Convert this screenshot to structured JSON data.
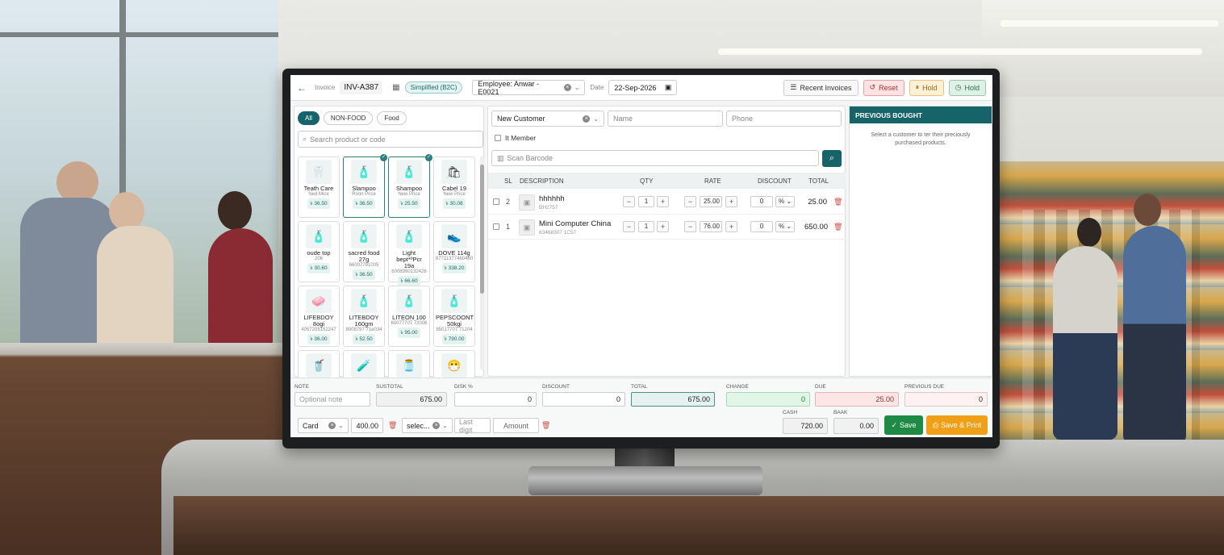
{
  "topbar": {
    "invoice_label": "Invoice",
    "invoice_no": "INV-A387",
    "mode": "Simplified (B2C)",
    "employee": "Employee: Anwar - E0021",
    "date_label": "Date",
    "date": "22-Sep-2026",
    "recent_invoices": "Recent Invoices",
    "reset": "Reset",
    "hold": "Hold",
    "hold2": "Hold"
  },
  "categories": [
    "All",
    "NON-FOOD",
    "Food"
  ],
  "search_placeholder": "Search product or code",
  "products": [
    {
      "name": "Teath Care",
      "sub": "Ned Mice",
      "price": "৳ 36.50",
      "icon": "tooth-icon",
      "glyph": "🦷",
      "selected": false
    },
    {
      "name": "Slampoo",
      "sub": "Roon Price",
      "price": "৳ 36.50",
      "icon": "bottle-icon",
      "glyph": "🧴",
      "selected": true
    },
    {
      "name": "Shampoo",
      "sub": "New Price",
      "price": "৳ 25.50",
      "icon": "bottle-icon",
      "glyph": "🧴",
      "selected": true
    },
    {
      "name": "Cabel 19",
      "sub": "New Price",
      "price": "৳ 30.08",
      "icon": "bag-icon",
      "glyph": "🛍",
      "selected": false
    },
    {
      "name": "oude top",
      "sub": "206",
      "price": "৳ 30.60",
      "icon": "bottle-icon",
      "glyph": "🧴",
      "selected": false
    },
    {
      "name": "sacred food 27g",
      "sub": "66007791005",
      "price": "৳ 36.50",
      "icon": "bottle-icon",
      "glyph": "🧴",
      "selected": false
    },
    {
      "name": "Light bept*ºPcr 19a",
      "sub": "6008990132426",
      "price": "৳ 66.60",
      "icon": "bottle-icon",
      "glyph": "🧴",
      "selected": false
    },
    {
      "name": "DOVE 114g",
      "sub": "87711377460460",
      "price": "৳ 338.20",
      "icon": "shoe-icon",
      "glyph": "👟",
      "selected": false
    },
    {
      "name": "LIFEBDOY 8ogi",
      "sub": "4057205152247",
      "price": "৳ 36.00",
      "icon": "soap-icon",
      "glyph": "🧼",
      "selected": false
    },
    {
      "name": "LITEBDOY 160gm",
      "sub": "8008797 71e034",
      "price": "৳ 52.50",
      "icon": "bottle-icon",
      "glyph": "🧴",
      "selected": false
    },
    {
      "name": "LITEON 100",
      "sub": "60077707 72006",
      "price": "৳ 95.00",
      "icon": "bottle-icon",
      "glyph": "🧴",
      "selected": false
    },
    {
      "name": "PEPSCOONT 50kgi",
      "sub": "85017707 71204",
      "price": "৳ 790.00",
      "icon": "bottle-icon",
      "glyph": "🧴",
      "selected": false
    },
    {
      "name": "",
      "sub": "",
      "price": "",
      "icon": "cup-icon",
      "glyph": "🥤",
      "selected": false
    },
    {
      "name": "",
      "sub": "",
      "price": "",
      "icon": "tube-icon",
      "glyph": "🧪",
      "selected": false
    },
    {
      "name": "",
      "sub": "",
      "price": "",
      "icon": "jar-icon",
      "glyph": "🫙",
      "selected": false
    },
    {
      "name": "",
      "sub": "",
      "price": "",
      "icon": "mask-icon",
      "glyph": "😷",
      "selected": false
    }
  ],
  "customer": {
    "select": "New Customer",
    "name_placeholder": "Name",
    "phone_placeholder": "Phone",
    "member_label": "It Member",
    "barcode_placeholder": "Scan Barcode"
  },
  "table": {
    "headers": {
      "sl": "SL",
      "description": "DESCRIPTION",
      "qty": "QTY",
      "rate": "RATE",
      "discount": "DISCOUNT",
      "total": "TOTAL"
    },
    "rows": [
      {
        "sl": "2",
        "name": "hhhhhh",
        "code": "BH2757",
        "qty": "1",
        "rate": "25.00",
        "discount": "0",
        "disc_type": "%",
        "total": "25.00"
      },
      {
        "sl": "1",
        "name": "Mini Computer China",
        "code": "83468307 1C57",
        "qty": "1",
        "rate": "76.00",
        "discount": "0",
        "disc_type": "%",
        "total": "650.00"
      }
    ]
  },
  "previous": {
    "title": "PREVIOUS BOUGHT",
    "text": "Select a customer to ter their preciously purchased products."
  },
  "summary": {
    "note_label": "NOTE",
    "note_placeholder": "Optional note",
    "subtotal_label": "SUSTOTAL",
    "subtotal": "675.00",
    "disk_label": "DISK %",
    "disk": "0",
    "discount_label": "DISCOUNT",
    "discount": "0",
    "total_label": "TOTAL",
    "total": "675.00",
    "change_label": "CHANGE",
    "change": "0",
    "due_label": "DUE",
    "due": "25.00",
    "prev_due_label": "PREVIOUS DUE",
    "prev_due": "0",
    "pay_method": "Card",
    "pay_amount": "400.00",
    "pay_method2": "selec...",
    "last_digit_placeholder": "Last digit",
    "amount_placeholder": "Amount",
    "cash_label": "CASH",
    "cash": "720.00",
    "bank_label": "BAAK",
    "bank": "0.00",
    "save": "Save",
    "save_print": "Save & Print"
  }
}
